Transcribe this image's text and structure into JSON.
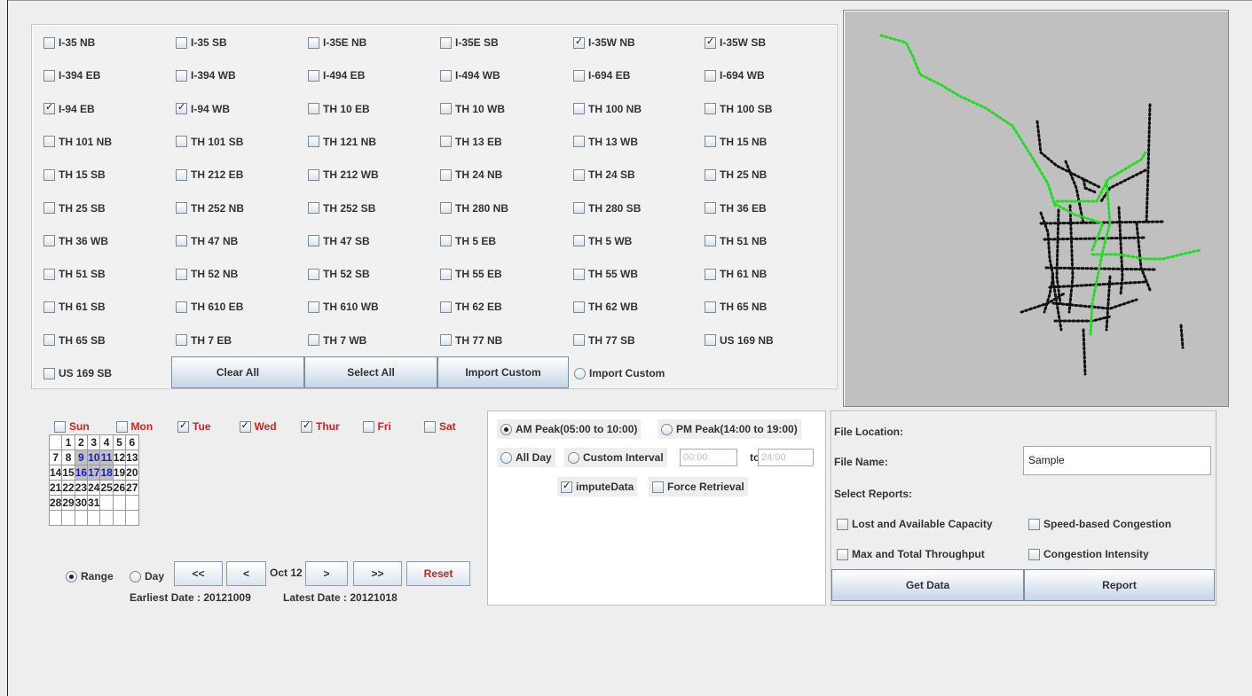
{
  "corridors": {
    "rows": [
      [
        {
          "label": "I-35 NB",
          "checked": false
        },
        {
          "label": "I-35 SB",
          "checked": false
        },
        {
          "label": "I-35E NB",
          "checked": false
        },
        {
          "label": "I-35E SB",
          "checked": false
        },
        {
          "label": "I-35W NB",
          "checked": true
        },
        {
          "label": "I-35W SB",
          "checked": true
        }
      ],
      [
        {
          "label": "I-394 EB",
          "checked": false
        },
        {
          "label": "I-394 WB",
          "checked": false
        },
        {
          "label": "I-494 EB",
          "checked": false
        },
        {
          "label": "I-494 WB",
          "checked": false
        },
        {
          "label": "I-694 EB",
          "checked": false
        },
        {
          "label": "I-694 WB",
          "checked": false
        }
      ],
      [
        {
          "label": "I-94 EB",
          "checked": true
        },
        {
          "label": "I-94 WB",
          "checked": true
        },
        {
          "label": "TH 10 EB",
          "checked": false
        },
        {
          "label": "TH 10 WB",
          "checked": false
        },
        {
          "label": "TH 100 NB",
          "checked": false
        },
        {
          "label": "TH 100 SB",
          "checked": false
        }
      ],
      [
        {
          "label": "TH 101 NB",
          "checked": false
        },
        {
          "label": "TH 101 SB",
          "checked": false
        },
        {
          "label": "TH 121 NB",
          "checked": false
        },
        {
          "label": "TH 13 EB",
          "checked": false
        },
        {
          "label": "TH 13 WB",
          "checked": false
        },
        {
          "label": "TH 15 NB",
          "checked": false
        }
      ],
      [
        {
          "label": "TH 15 SB",
          "checked": false
        },
        {
          "label": "TH 212 EB",
          "checked": false
        },
        {
          "label": "TH 212 WB",
          "checked": false
        },
        {
          "label": "TH 24 NB",
          "checked": false
        },
        {
          "label": "TH 24 SB",
          "checked": false
        },
        {
          "label": "TH 25 NB",
          "checked": false
        }
      ],
      [
        {
          "label": "TH 25 SB",
          "checked": false
        },
        {
          "label": "TH 252 NB",
          "checked": false
        },
        {
          "label": "TH 252 SB",
          "checked": false
        },
        {
          "label": "TH 280 NB",
          "checked": false
        },
        {
          "label": "TH 280 SB",
          "checked": false
        },
        {
          "label": "TH 36 EB",
          "checked": false
        }
      ],
      [
        {
          "label": "TH 36 WB",
          "checked": false
        },
        {
          "label": "TH 47 NB",
          "checked": false
        },
        {
          "label": "TH 47 SB",
          "checked": false
        },
        {
          "label": "TH 5 EB",
          "checked": false
        },
        {
          "label": "TH 5 WB",
          "checked": false
        },
        {
          "label": "TH 51 NB",
          "checked": false
        }
      ],
      [
        {
          "label": "TH 51 SB",
          "checked": false
        },
        {
          "label": "TH 52 NB",
          "checked": false
        },
        {
          "label": "TH 52 SB",
          "checked": false
        },
        {
          "label": "TH 55 EB",
          "checked": false
        },
        {
          "label": "TH 55 WB",
          "checked": false
        },
        {
          "label": "TH 61 NB",
          "checked": false
        }
      ],
      [
        {
          "label": "TH 61 SB",
          "checked": false
        },
        {
          "label": "TH 610 EB",
          "checked": false
        },
        {
          "label": "TH 610 WB",
          "checked": false
        },
        {
          "label": "TH 62 EB",
          "checked": false
        },
        {
          "label": "TH 62 WB",
          "checked": false
        },
        {
          "label": "TH 65 NB",
          "checked": false
        }
      ],
      [
        {
          "label": "TH 65 SB",
          "checked": false
        },
        {
          "label": "TH 7 EB",
          "checked": false
        },
        {
          "label": "TH 7 WB",
          "checked": false
        },
        {
          "label": "TH 77 NB",
          "checked": false
        },
        {
          "label": "TH 77 SB",
          "checked": false
        },
        {
          "label": "US 169 NB",
          "checked": false
        }
      ]
    ],
    "last": {
      "label": "US 169 SB",
      "checked": false
    },
    "clear_all": "Clear All",
    "select_all": "Select All",
    "import_custom_button": "Import Custom",
    "import_custom_radio": "Import Custom"
  },
  "calendar": {
    "days": [
      {
        "label": "Sun",
        "checked": false,
        "color": "#d42020"
      },
      {
        "label": "Mon",
        "checked": false,
        "color": "#d42020"
      },
      {
        "label": "Tue",
        "checked": true,
        "color": "#d42020"
      },
      {
        "label": "Wed",
        "checked": true,
        "color": "#d42020"
      },
      {
        "label": "Thur",
        "checked": true,
        "color": "#d42020"
      },
      {
        "label": "Fri",
        "checked": false,
        "color": "#d42020"
      },
      {
        "label": "Sat",
        "checked": false,
        "color": "#d42020"
      }
    ],
    "weeks": [
      [
        "",
        "1",
        "2",
        "3",
        "4",
        "5",
        "6"
      ],
      [
        "7",
        "8",
        "9",
        "10",
        "11",
        "12",
        "13"
      ],
      [
        "14",
        "15",
        "16",
        "17",
        "18",
        "19",
        "20"
      ],
      [
        "21",
        "22",
        "23",
        "24",
        "25",
        "26",
        "27"
      ],
      [
        "28",
        "29",
        "30",
        "31",
        "",
        "",
        ""
      ],
      [
        "",
        "",
        "",
        "",
        "",
        "",
        ""
      ]
    ],
    "selected": [
      "9",
      "10",
      "11",
      "16",
      "17",
      "18"
    ],
    "range_label": "Range",
    "day_label": "Day",
    "nav_first": "<<",
    "nav_prev": "<",
    "month": "Oct 12",
    "nav_next": ">",
    "nav_last": ">>",
    "reset": "Reset",
    "earliest": "Earliest Date :  20121009",
    "latest": "Latest Date :  20121018"
  },
  "time": {
    "am_peak": "AM Peak(05:00 to 10:00)",
    "pm_peak": "PM Peak(14:00 to 19:00)",
    "all_day": "All Day",
    "custom_interval": "Custom Interval",
    "start": "00:00",
    "to": "to",
    "end": "24:00",
    "impute": "imputeData",
    "force": "Force Retrieval"
  },
  "report": {
    "file_location": "File Location:",
    "file_name_label": "File Name:",
    "file_name": "Sample",
    "select_reports": "Select Reports:",
    "lost_capacity": "Lost and Available Capacity",
    "speed_congestion": "Speed-based Congestion",
    "max_throughput": "Max and Total Throughput",
    "congestion_intensity": "Congestion Intensity",
    "get_data": "Get Data",
    "report_btn": "Report"
  },
  "colors": {
    "map_bg": "#c0c0c0",
    "road": "#111111",
    "selected_road": "#22dd22"
  }
}
